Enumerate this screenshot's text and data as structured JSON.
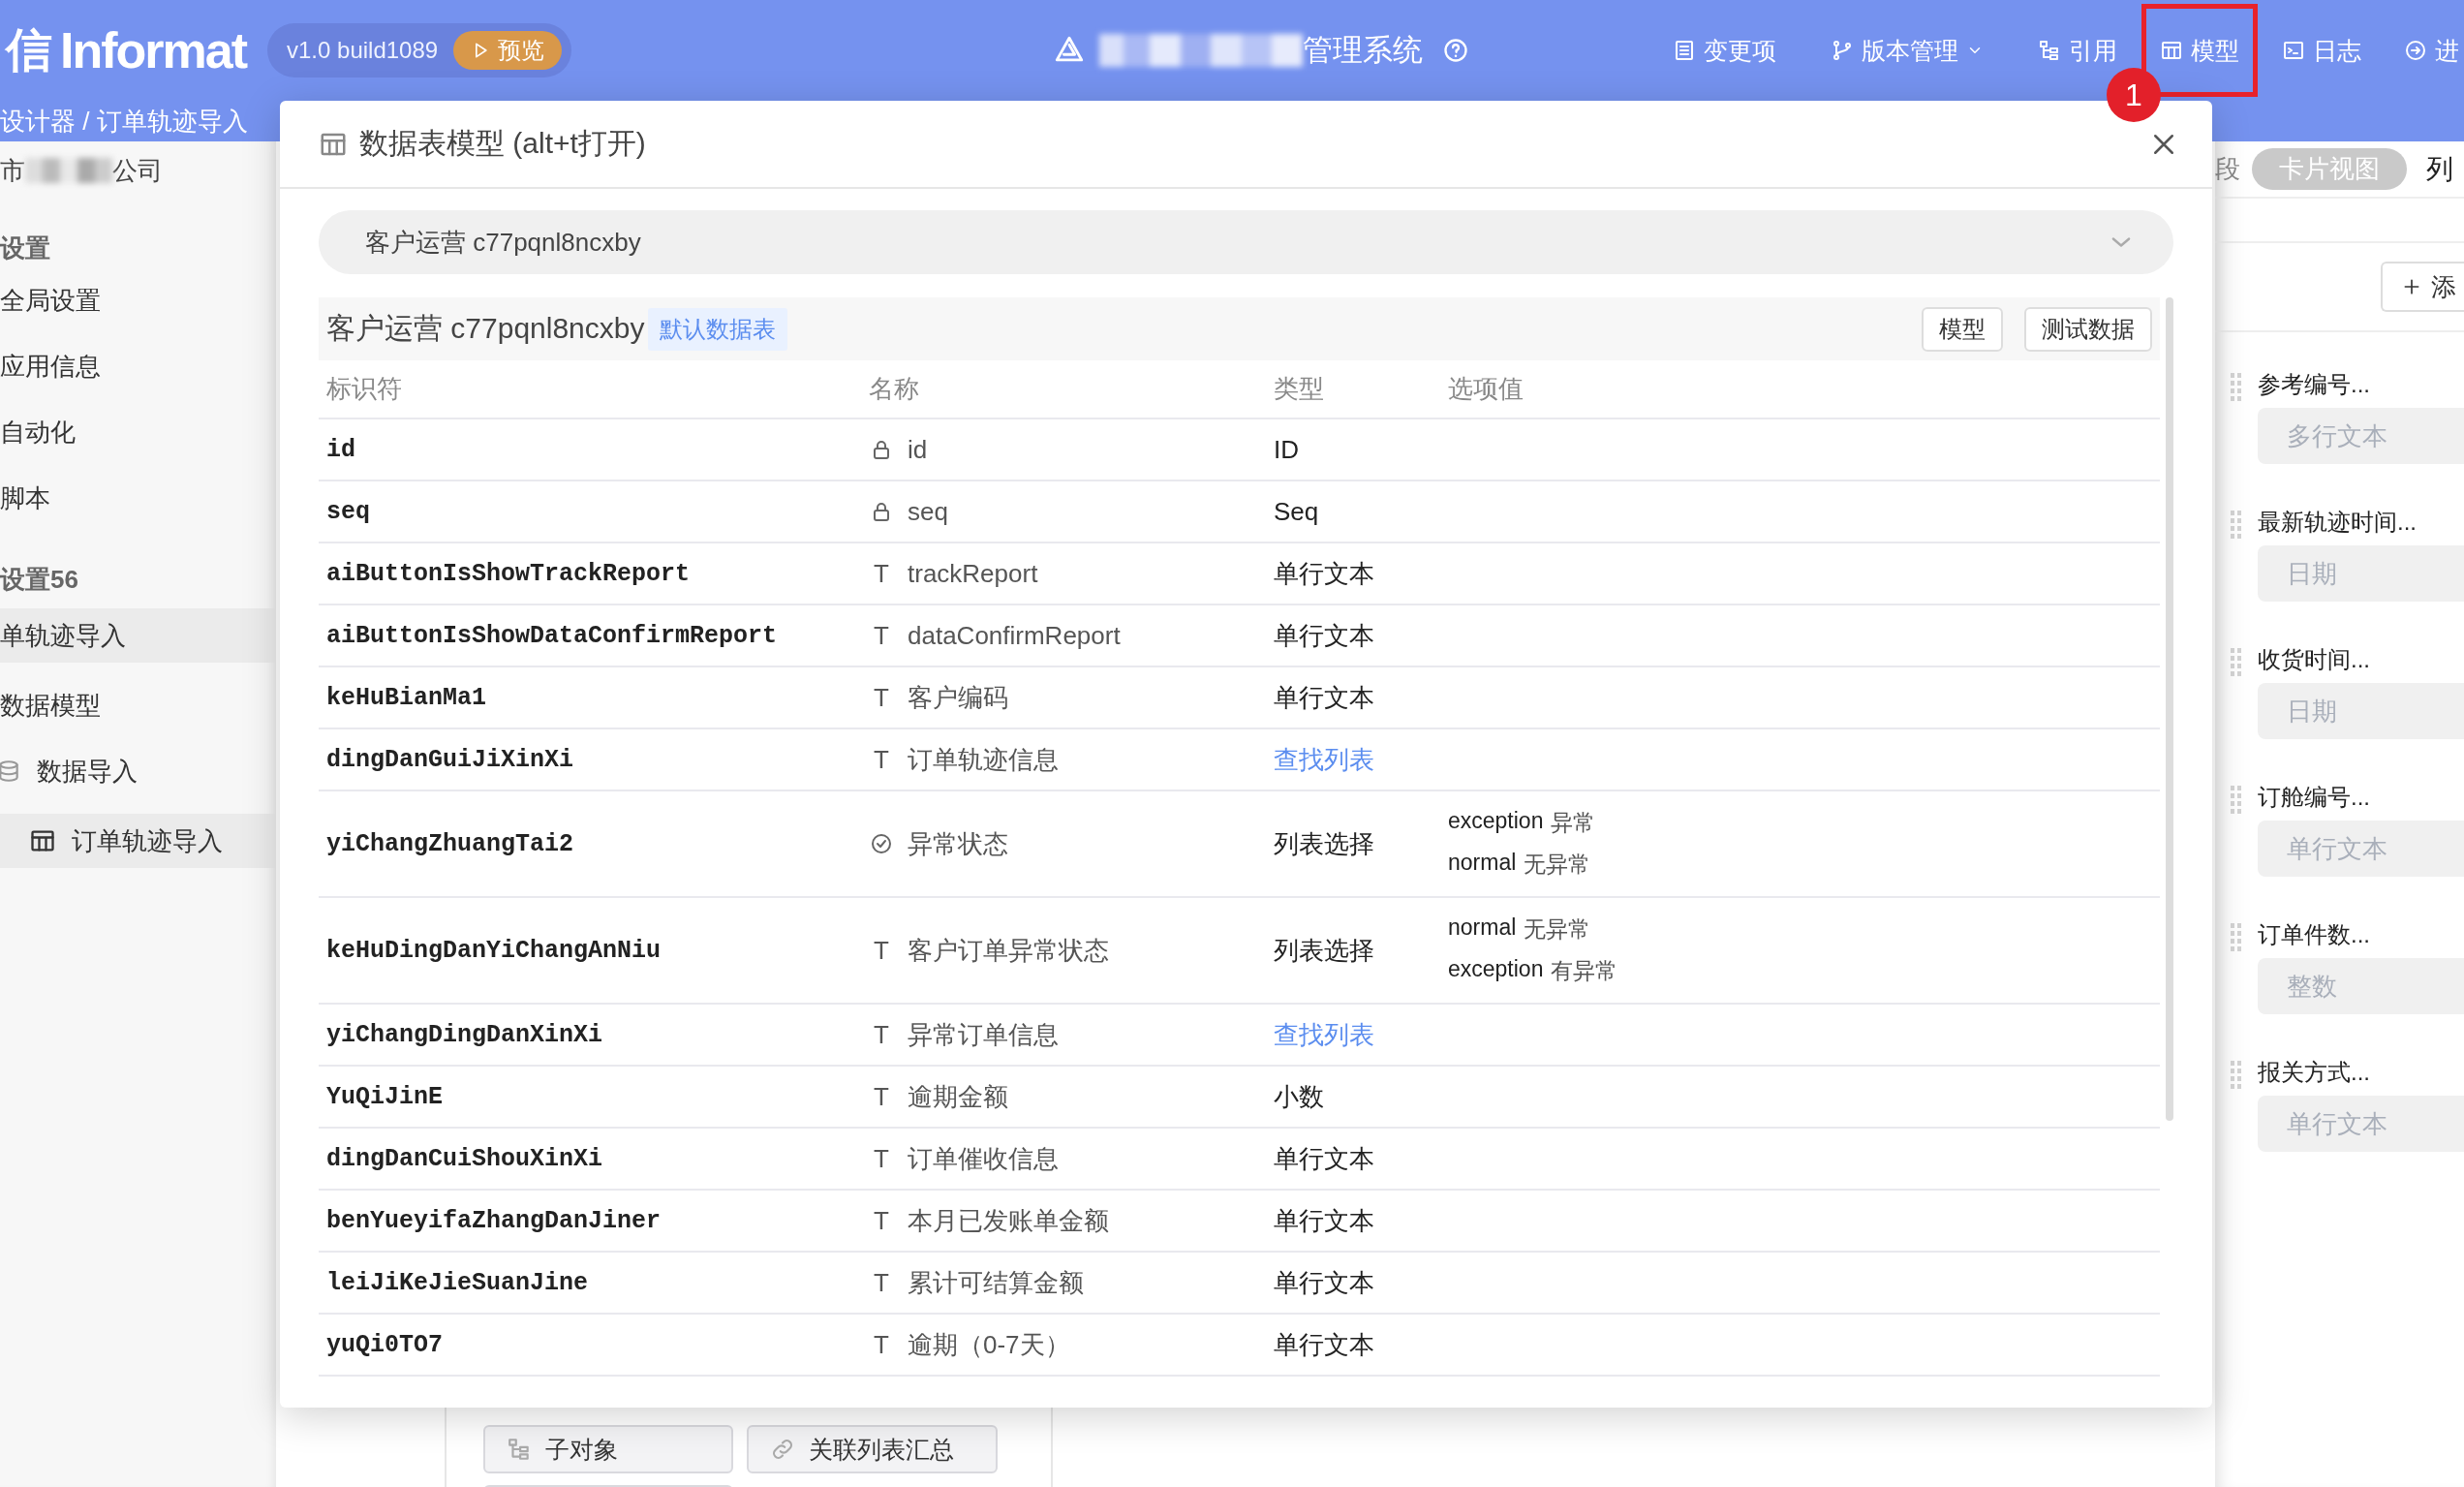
{
  "header": {
    "logo_mark": "信",
    "logo": "Informat",
    "version": "v1.0 build1089",
    "preview_button": "预览",
    "app_title": "管理系统",
    "nav": [
      {
        "label": "变更项",
        "dropdown": false,
        "highlighted": false
      },
      {
        "label": "版本管理",
        "dropdown": true,
        "highlighted": false
      },
      {
        "label": "引用",
        "dropdown": false,
        "highlighted": false
      },
      {
        "label": "模型",
        "dropdown": false,
        "highlighted": true
      },
      {
        "label": "日志",
        "dropdown": false,
        "highlighted": false
      },
      {
        "label": "进",
        "dropdown": false,
        "highlighted": false
      }
    ],
    "step_badge": "1"
  },
  "breadcrumb": "设计器 / 订单轨迹导入",
  "sidebar": {
    "company_prefix": "市",
    "company_suffix": "公司",
    "items": [
      {
        "kind": "heading",
        "label": "设置"
      },
      {
        "kind": "item",
        "label": "全局设置",
        "selected": false
      },
      {
        "kind": "item",
        "label": "应用信息",
        "selected": false
      },
      {
        "kind": "item",
        "label": "自动化",
        "selected": false
      },
      {
        "kind": "item",
        "label": "脚本",
        "selected": false
      },
      {
        "kind": "heading",
        "label": "设置56"
      },
      {
        "kind": "item",
        "label": "单轨迹导入",
        "selected": true
      },
      {
        "kind": "item",
        "label": "数据模型",
        "selected": false
      },
      {
        "kind": "database",
        "label": "数据导入",
        "selected": false,
        "children": [
          {
            "kind": "table",
            "label": "订单轨迹导入",
            "selected": true
          }
        ]
      }
    ]
  },
  "content_buttons": [
    "子对象",
    "关联列表汇总"
  ],
  "right_panel": {
    "section_tail": "段",
    "view_pill": "卡片视图",
    "view_tail": "列",
    "add_button": "添",
    "fields": [
      {
        "label": "参考编号...",
        "placeholder": "多行文本"
      },
      {
        "label": "最新轨迹时间...",
        "placeholder": "日期"
      },
      {
        "label": "收货时间...",
        "placeholder": "日期"
      },
      {
        "label": "订舱编号...",
        "placeholder": "单行文本"
      },
      {
        "label": "订单件数...",
        "placeholder": "整数"
      },
      {
        "label": "报关方式...",
        "placeholder": "单行文本"
      }
    ]
  },
  "modal": {
    "title": "数据表模型 (alt+t打开)",
    "select_value": "客户运营 c77pqnl8ncxby",
    "table_name": "客户运营 c77pqnl8ncxby",
    "default_tag": "默认数据表",
    "buttons": [
      "模型",
      "测试数据"
    ],
    "columns": [
      "标识符",
      "名称",
      "类型",
      "选项值"
    ],
    "rows": [
      {
        "identifier": "id",
        "kind": "locked",
        "name": "id",
        "type": "ID",
        "type_link": false
      },
      {
        "identifier": "seq",
        "kind": "locked",
        "name": "seq",
        "type": "Seq",
        "type_link": false
      },
      {
        "identifier": "aiButtonIsShowTrackReport",
        "kind": "text",
        "icon": "T",
        "name": "trackReport",
        "type": "单行文本",
        "type_link": false
      },
      {
        "identifier": "aiButtonIsShowDataConfirmReport",
        "kind": "text",
        "icon": "T",
        "name": "dataConfirmReport",
        "type": "单行文本",
        "type_link": false
      },
      {
        "identifier": "keHuBianMa1",
        "kind": "text",
        "icon": "T",
        "name": "客户编码",
        "type": "单行文本",
        "type_link": false
      },
      {
        "identifier": "dingDanGuiJiXinXi",
        "kind": "text",
        "icon": "T",
        "name": "订单轨迹信息",
        "type": "查找列表",
        "type_link": true
      },
      {
        "identifier": "yiChangZhuangTai2",
        "kind": "choice",
        "name": "异常状态",
        "type": "列表选择",
        "type_link": false,
        "options": [
          {
            "key": "exception",
            "label": "异常"
          },
          {
            "key": "normal",
            "label": "无异常"
          }
        ]
      },
      {
        "identifier": "keHuDingDanYiChangAnNiu",
        "kind": "text",
        "icon": "T",
        "name": "客户订单异常状态",
        "type": "列表选择",
        "type_link": false,
        "options": [
          {
            "key": "normal",
            "label": "无异常"
          },
          {
            "key": "exception",
            "label": "有异常"
          }
        ]
      },
      {
        "identifier": "yiChangDingDanXinXi",
        "kind": "text",
        "icon": "T",
        "name": "异常订单信息",
        "type": "查找列表",
        "type_link": true
      },
      {
        "identifier": "YuQiJinE",
        "kind": "text",
        "icon": "T",
        "name": "逾期金额",
        "type": "小数",
        "type_link": false
      },
      {
        "identifier": "dingDanCuiShouXinXi",
        "kind": "text",
        "icon": "T",
        "name": "订单催收信息",
        "type": "单行文本",
        "type_link": false
      },
      {
        "identifier": "benYueyifaZhangDanJiner",
        "kind": "text",
        "icon": "T",
        "name": "本月已发账单金额",
        "type": "单行文本",
        "type_link": false
      },
      {
        "identifier": "leiJiKeJieSuanJine",
        "kind": "text",
        "icon": "T",
        "name": "累计可结算金额",
        "type": "单行文本",
        "type_link": false
      },
      {
        "identifier": "yuQi0TO7",
        "kind": "text",
        "icon": "T",
        "name": "逾期（0-7天）",
        "type": "单行文本",
        "type_link": false
      }
    ]
  }
}
